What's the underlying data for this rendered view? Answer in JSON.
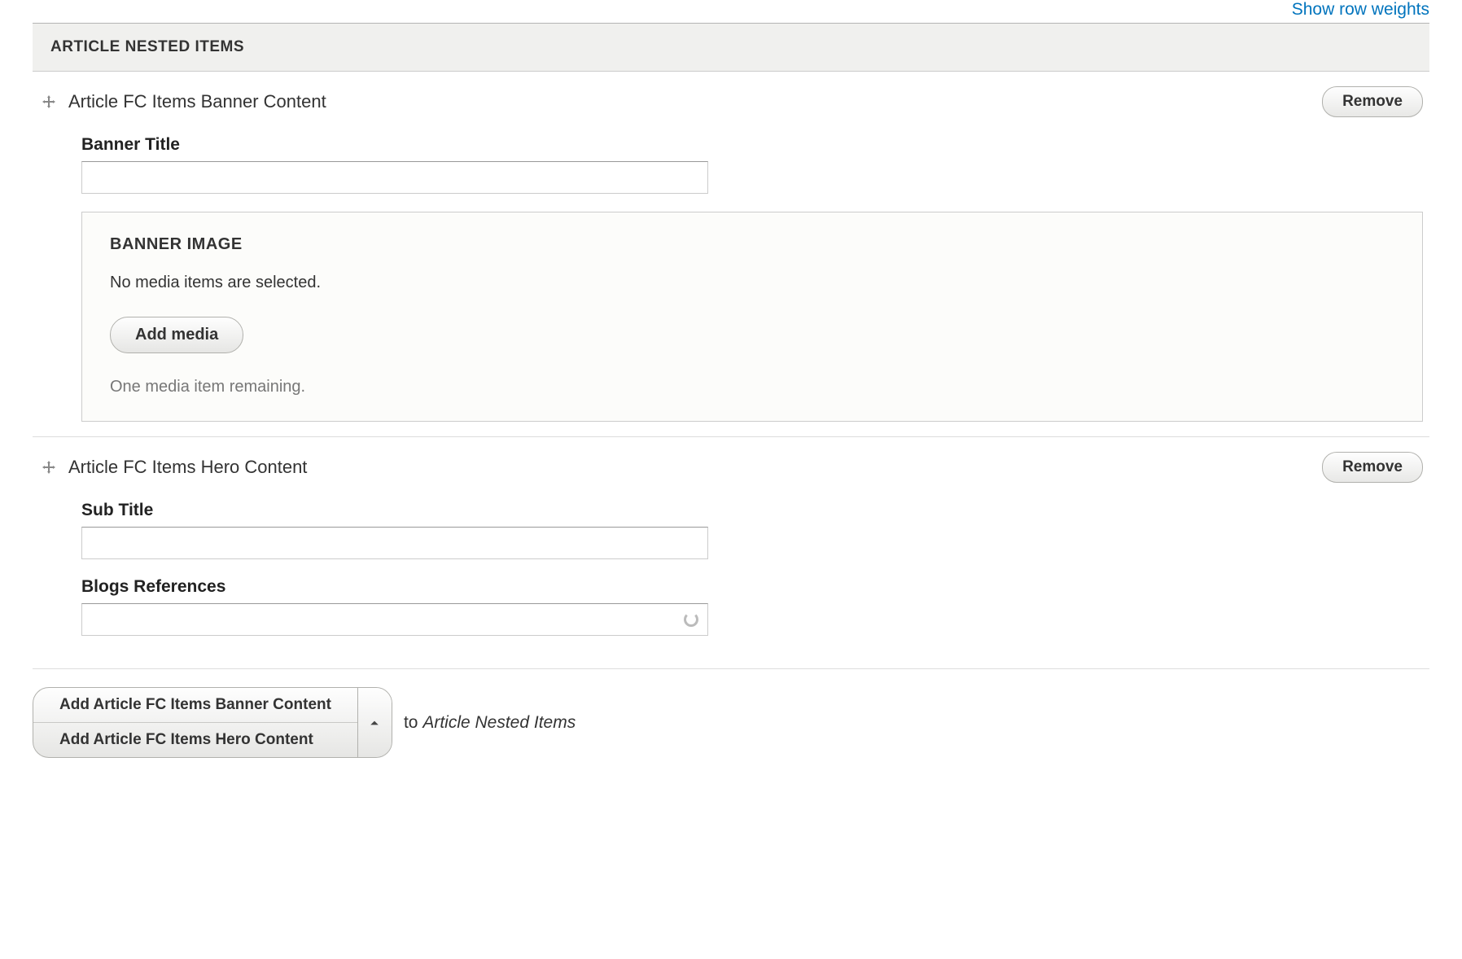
{
  "showRowWeights": "Show row weights",
  "sectionHeader": "ARTICLE NESTED ITEMS",
  "items": [
    {
      "title": "Article FC Items Banner Content",
      "removeLabel": "Remove",
      "fields": {
        "bannerTitleLabel": "Banner Title",
        "bannerTitleValue": "",
        "bannerImageLegend": "BANNER IMAGE",
        "noMediaText": "No media items are selected.",
        "addMediaLabel": "Add media",
        "remainingText": "One media item remaining."
      }
    },
    {
      "title": "Article FC Items Hero Content",
      "removeLabel": "Remove",
      "fields": {
        "subTitleLabel": "Sub Title",
        "subTitleValue": "",
        "blogsRefLabel": "Blogs References",
        "blogsRefValue": ""
      }
    }
  ],
  "addButtons": {
    "btn1": "Add Article FC Items Banner Content",
    "btn2": "Add Article FC Items Hero Content",
    "toText": "to",
    "targetName": "Article Nested Items"
  }
}
